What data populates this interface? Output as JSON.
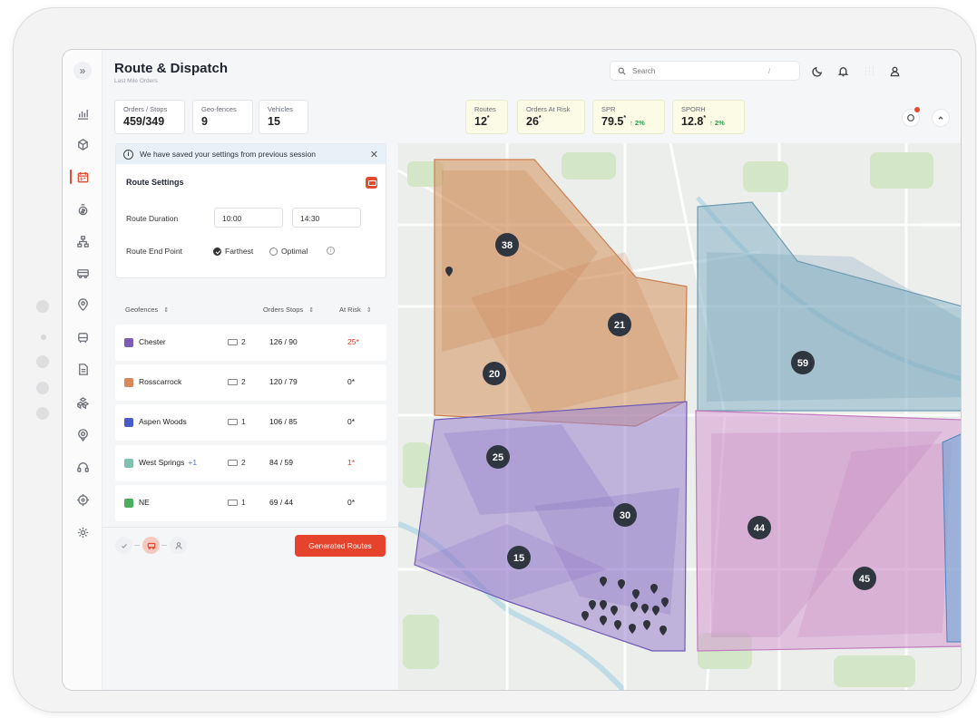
{
  "header": {
    "title": "Route & Dispatch",
    "subtitle": "Last Mile Orders",
    "search_placeholder": "Search",
    "search_shortcut": "/"
  },
  "stats_left": [
    {
      "label": "Orders / Stops",
      "value": "459/349"
    },
    {
      "label": "Geo-fences",
      "value": "9"
    },
    {
      "label": "Vehicles",
      "value": "15"
    }
  ],
  "stats_right": [
    {
      "label": "Routes",
      "value": "12",
      "suffix": "*"
    },
    {
      "label": "Orders At Risk",
      "value": "26",
      "suffix": "*"
    },
    {
      "label": "SPR",
      "value": "79.5",
      "suffix": "*",
      "delta": "↑ 2%"
    },
    {
      "label": "SPORH",
      "value": "12.8",
      "suffix": "*",
      "delta": "↑ 2%"
    }
  ],
  "info_banner": {
    "text": "We have saved your settings from previous session",
    "close": "✕",
    "icon": "i"
  },
  "route_settings": {
    "title": "Route Settings",
    "duration_label": "Route Duration",
    "duration_start": "10:00",
    "duration_end": "14:30",
    "endpoint_label": "Route End Point",
    "option_farthest": "Farthest",
    "option_optimal": "Optimal",
    "selected": "Farthest",
    "info_icon": "i"
  },
  "table": {
    "headers": {
      "geofences": "Geofences",
      "orders_stops": "Orders  Stops",
      "at_risk": "At Risk"
    },
    "sort_icon": "⇕",
    "rows": [
      {
        "name": "Chester",
        "extra": "",
        "color": "#7d5cb3",
        "vehicles": "2",
        "orders_stops": "126  /  90",
        "at_risk": "25*",
        "risk_red": true
      },
      {
        "name": "Rosscarrock",
        "extra": "",
        "color": "#d6895a",
        "vehicles": "2",
        "orders_stops": "120  /  79",
        "at_risk": "0*",
        "risk_red": false
      },
      {
        "name": "Aspen Woods",
        "extra": "",
        "color": "#4a5cc9",
        "vehicles": "1",
        "orders_stops": "106  /  85",
        "at_risk": "0*",
        "risk_red": false
      },
      {
        "name": "West Springs",
        "extra": "+1",
        "color": "#7ec1b0",
        "vehicles": "2",
        "orders_stops": "84  /  59",
        "at_risk": "1*",
        "risk_red": true
      },
      {
        "name": "NE",
        "extra": "",
        "color": "#4cae5d",
        "vehicles": "1",
        "orders_stops": "69  /  44",
        "at_risk": "0*",
        "risk_red": false
      }
    ]
  },
  "actions": {
    "generate": "Generated  Routes"
  },
  "map": {
    "clusters": [
      "38",
      "21",
      "20",
      "59",
      "25",
      "30",
      "15",
      "44",
      "45"
    ],
    "zone_colors": {
      "orange": "#d7935f",
      "blue": "#86b3c7",
      "purple": "#9b83cf",
      "pink": "#d59bd1"
    }
  },
  "colors": {
    "accent": "#e5432b",
    "highlight_card": "#fbfbe6",
    "positive": "#2f9a4e"
  },
  "icons": {
    "rail": [
      "chart-icon",
      "cube-icon",
      "calendar-icon",
      "money-icon",
      "hierarchy-icon",
      "truck-icon",
      "location-icon",
      "vehicle-icon",
      "document-icon",
      "boxes-icon",
      "map-pin-icon",
      "headset-icon",
      "target-icon",
      "settings-icon"
    ],
    "header": [
      "moon-icon",
      "bell-icon",
      "grid-icon",
      "user-icon"
    ]
  }
}
